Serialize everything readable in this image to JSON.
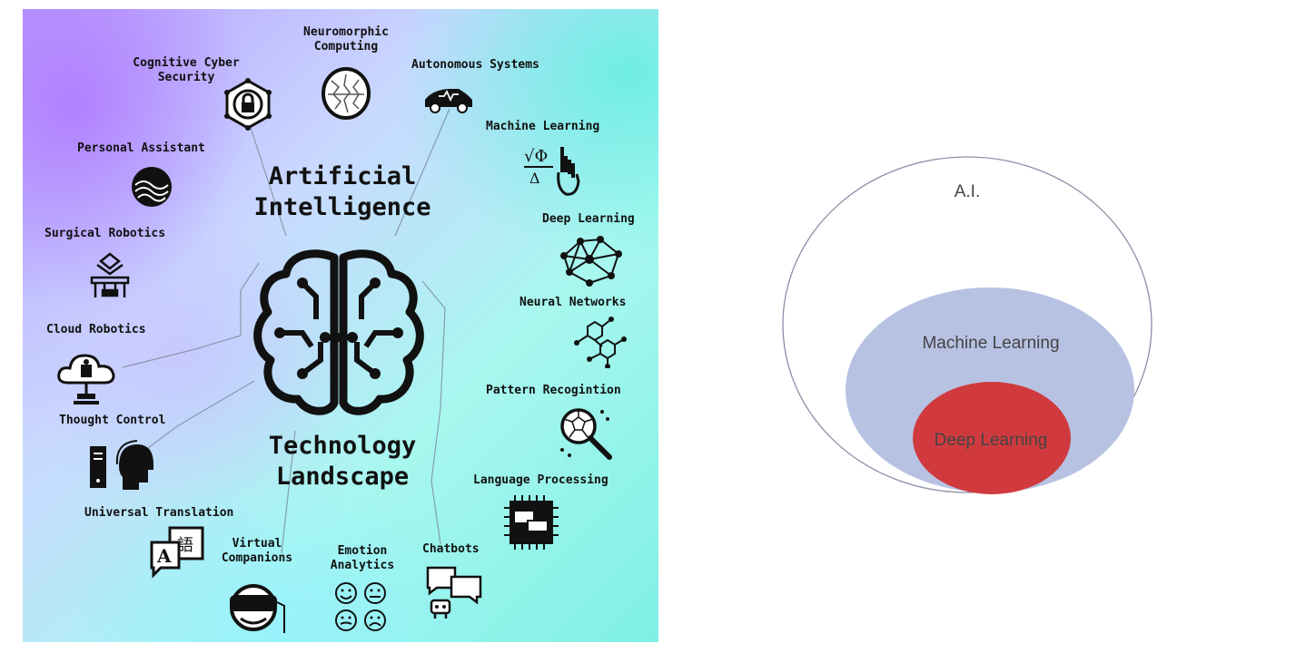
{
  "infographic": {
    "title": "Artificial\nIntelligence",
    "subtitle": "Technology\nLandscape",
    "labels": {
      "neuromorphic": "Neuromorphic\nComputing",
      "cognitive_cyber": "Cognitive Cyber\nSecurity",
      "autonomous": "Autonomous Systems",
      "personal_assistant": "Personal Assistant",
      "machine_learning": "Machine Learning",
      "surgical_robotics": "Surgical Robotics",
      "deep_learning": "Deep Learning",
      "neural_networks": "Neural Networks",
      "cloud_robotics": "Cloud Robotics",
      "pattern_recognition": "Pattern Recogintion",
      "thought_control": "Thought Control",
      "language_processing": "Language Processing",
      "universal_translation": "Universal Translation",
      "virtual_companions": "Virtual\nCompanions",
      "emotion_analytics": "Emotion\nAnalytics",
      "chatbots": "Chatbots"
    }
  },
  "venn": {
    "outer_label": "A.I.",
    "middle_label": "Machine Learning",
    "inner_label": "Deep Learning",
    "colors": {
      "outer_stroke": "#8a8fa8",
      "middle_fill": "#b7c2e3",
      "inner_fill": "#d03a3e"
    }
  }
}
